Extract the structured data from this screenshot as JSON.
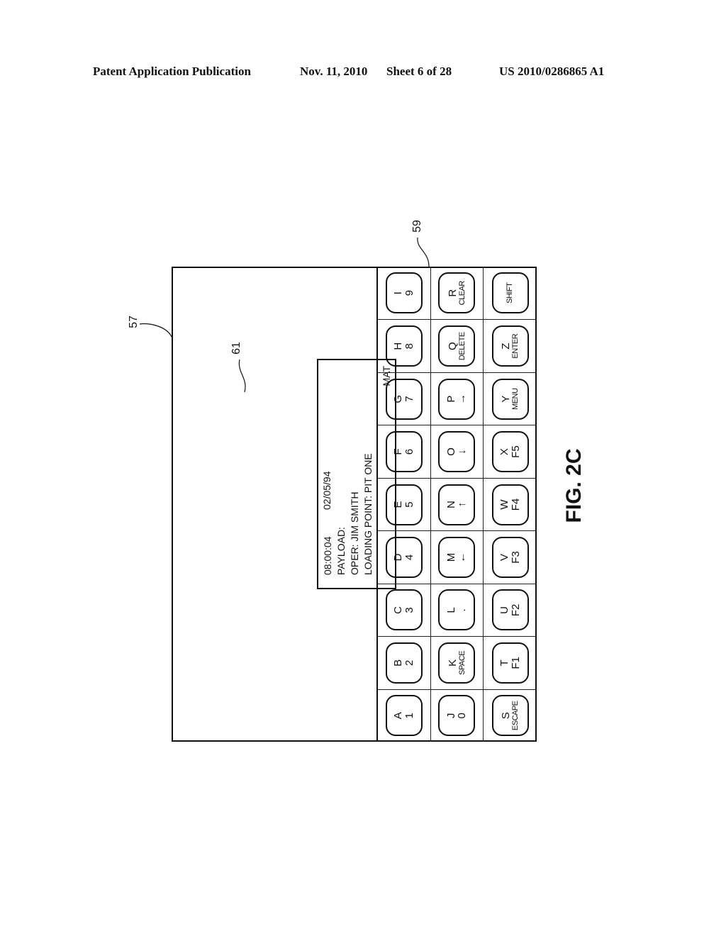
{
  "header": {
    "publication": "Patent Application Publication",
    "date": "Nov. 11, 2010",
    "sheet": "Sheet 6 of 28",
    "number": "US 2010/0286865 A1"
  },
  "figure_label": "FIG. 2C",
  "refs": {
    "device": "57",
    "keypad": "59",
    "display": "61"
  },
  "display": {
    "time": "08:00:04",
    "date": "02/05/94",
    "line2": "PAYLOAD:",
    "line3": "OPER: JIM SMITH",
    "line4": "LOADING POINT: PIT ONE",
    "corner": "MAT"
  },
  "keys": [
    {
      "top": "A",
      "bottom": "1"
    },
    {
      "top": "B",
      "bottom": "2"
    },
    {
      "top": "C",
      "bottom": "3"
    },
    {
      "top": "D",
      "bottom": "4"
    },
    {
      "top": "E",
      "bottom": "5"
    },
    {
      "top": "F",
      "bottom": "6"
    },
    {
      "top": "G",
      "bottom": "7"
    },
    {
      "top": "H",
      "bottom": "8"
    },
    {
      "top": "I",
      "bottom": "9"
    },
    {
      "top": "J",
      "bottom": "0"
    },
    {
      "top": "K",
      "bottom": "SPACE",
      "small": true
    },
    {
      "top": "L",
      "bottom": "."
    },
    {
      "top": "M",
      "bottom": "←"
    },
    {
      "top": "N",
      "bottom": "↑"
    },
    {
      "top": "O",
      "bottom": "↓"
    },
    {
      "top": "P",
      "bottom": "→"
    },
    {
      "top": "Q",
      "bottom": "DELETE",
      "small": true
    },
    {
      "top": "R",
      "bottom": "CLEAR",
      "small": true
    },
    {
      "top": "S",
      "bottom": "ESCAPE",
      "small": true
    },
    {
      "top": "T",
      "bottom": "F1"
    },
    {
      "top": "U",
      "bottom": "F2"
    },
    {
      "top": "V",
      "bottom": "F3"
    },
    {
      "top": "W",
      "bottom": "F4"
    },
    {
      "top": "X",
      "bottom": "F5"
    },
    {
      "top": "Y",
      "bottom": "MENU",
      "small": true
    },
    {
      "top": "Z",
      "bottom": "ENTER",
      "small": true
    },
    {
      "top": "",
      "bottom": "SHIFT",
      "small": true
    }
  ]
}
